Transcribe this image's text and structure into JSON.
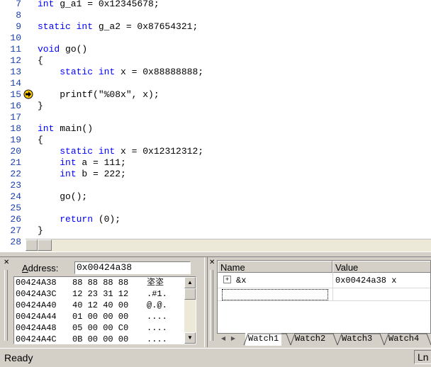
{
  "editor": {
    "lines": [
      {
        "num": "7",
        "segments": [
          {
            "t": "int",
            "kw": true
          },
          {
            "t": " g_a1 = 0x12345678;"
          }
        ]
      },
      {
        "num": "8",
        "segments": []
      },
      {
        "num": "9",
        "segments": [
          {
            "t": "static int",
            "kw": true
          },
          {
            "t": " g_a2 = 0x87654321;"
          }
        ]
      },
      {
        "num": "10",
        "segments": []
      },
      {
        "num": "11",
        "segments": [
          {
            "t": "void",
            "kw": true
          },
          {
            "t": " go()"
          }
        ]
      },
      {
        "num": "12",
        "segments": [
          {
            "t": "{"
          }
        ]
      },
      {
        "num": "13",
        "segments": [
          {
            "t": "    "
          },
          {
            "t": "static int",
            "kw": true
          },
          {
            "t": " x = 0x88888888;"
          }
        ]
      },
      {
        "num": "14",
        "segments": []
      },
      {
        "num": "15",
        "segments": [
          {
            "t": "    printf(\"%08x\", x);"
          }
        ]
      },
      {
        "num": "16",
        "segments": [
          {
            "t": "}"
          }
        ]
      },
      {
        "num": "17",
        "segments": []
      },
      {
        "num": "18",
        "segments": [
          {
            "t": "int",
            "kw": true
          },
          {
            "t": " main()"
          }
        ]
      },
      {
        "num": "19",
        "segments": [
          {
            "t": "{"
          }
        ]
      },
      {
        "num": "20",
        "segments": [
          {
            "t": "    "
          },
          {
            "t": "static int",
            "kw": true
          },
          {
            "t": " x = 0x12312312;"
          }
        ]
      },
      {
        "num": "21",
        "segments": [
          {
            "t": "    "
          },
          {
            "t": "int",
            "kw": true
          },
          {
            "t": " a = 111;"
          }
        ]
      },
      {
        "num": "22",
        "segments": [
          {
            "t": "    "
          },
          {
            "t": "int",
            "kw": true
          },
          {
            "t": " b = 222;"
          }
        ]
      },
      {
        "num": "23",
        "segments": []
      },
      {
        "num": "24",
        "segments": [
          {
            "t": "    go();"
          }
        ]
      },
      {
        "num": "25",
        "segments": []
      },
      {
        "num": "26",
        "segments": [
          {
            "t": "    "
          },
          {
            "t": "return",
            "kw": true
          },
          {
            "t": " (0);"
          }
        ]
      },
      {
        "num": "27",
        "segments": [
          {
            "t": "}"
          }
        ]
      },
      {
        "num": "28",
        "segments": []
      }
    ],
    "current_line_icon": "current-line-arrow-icon"
  },
  "memory": {
    "address_label_prefix": "",
    "address_label_hotkey": "A",
    "address_label_rest": "ddress:",
    "address_value": "0x00424a38",
    "rows": [
      {
        "addr": "00424A38",
        "bytes": "88 88 88 88",
        "ascii": "垐垐"
      },
      {
        "addr": "00424A3C",
        "bytes": "12 23 31 12",
        "ascii": ".#1."
      },
      {
        "addr": "00424A40",
        "bytes": "40 12 40 00",
        "ascii": "@.@."
      },
      {
        "addr": "00424A44",
        "bytes": "01 00 00 00",
        "ascii": "...."
      },
      {
        "addr": "00424A48",
        "bytes": "05 00 00 C0",
        "ascii": "...."
      },
      {
        "addr": "00424A4C",
        "bytes": "0B 00 00 00",
        "ascii": "...."
      }
    ]
  },
  "watch": {
    "col_name": "Name",
    "col_value": "Value",
    "items": [
      {
        "expand": "+",
        "name": "&x",
        "value": "0x00424a38 x"
      }
    ],
    "tabs": [
      "Watch1",
      "Watch2",
      "Watch3",
      "Watch4"
    ],
    "active_tab": 0
  },
  "status": {
    "text": "Ready",
    "ln_label": "Ln"
  },
  "colors": {
    "keyword": "#0000ff",
    "line_number": "#1a3fb0",
    "arrow_fill": "#ffcc00"
  }
}
